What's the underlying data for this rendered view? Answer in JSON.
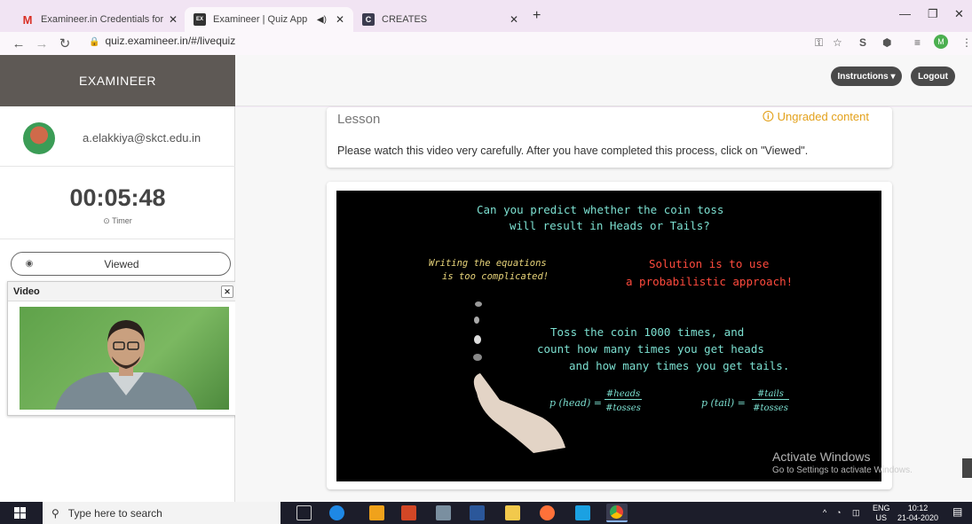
{
  "browser": {
    "tabs": [
      {
        "label": "Examineer.in Credentials for Quiz",
        "favicon": "M"
      },
      {
        "label": "Examineer | Quiz App",
        "favicon": "EX"
      },
      {
        "label": "CREATES",
        "favicon": "C"
      }
    ],
    "url": "quiz.examineer.in/#/livequiz",
    "profile_initial": "M"
  },
  "app": {
    "brand": "EXAMINEER",
    "instructions_label": "Instructions ▾",
    "logout_label": "Logout"
  },
  "sidebar": {
    "email": "a.elakkiya@skct.edu.in",
    "timer_value": "00:05:48",
    "timer_label": "⊙ Timer",
    "viewed_label": "Viewed",
    "video_title": "Video",
    "video_close": "✕"
  },
  "lesson": {
    "title": "Lesson",
    "badge": "Ungraded content",
    "text": "Please watch this video very carefully. After you have completed this process, click on \"Viewed\"."
  },
  "video": {
    "question_line1": "Can you predict whether the coin toss",
    "question_line2": "will result in Heads or Tails?",
    "left_line1": "Writing the equations",
    "left_line2": "is too complicated!",
    "right_line1": "Solution is to use",
    "right_line2": "a probabilistic approach!",
    "toss_line1": "Toss the coin 1000 times, and",
    "toss_line2": "count how many times you get heads",
    "toss_line3": "and how many times you get tails.",
    "formula_head_lhs": "p (head) =",
    "formula_head_num": "#heads",
    "formula_head_den": "#tosses",
    "formula_tail_lhs": "p (tail) =",
    "formula_tail_num": "#tails",
    "formula_tail_den": "#tosses"
  },
  "watermark": {
    "line1": "Activate Windows",
    "line2": "Go to Settings to activate Windows."
  },
  "taskbar": {
    "search_placeholder": "Type here to search",
    "lang1": "ENG",
    "lang2": "US",
    "time": "10:12",
    "date": "21-04-2020"
  },
  "colors": {
    "accent_orange": "#e3a11b",
    "video_teal": "#7ce0d1",
    "video_yellow": "#e8d47a",
    "video_red": "#ff4a3d"
  }
}
